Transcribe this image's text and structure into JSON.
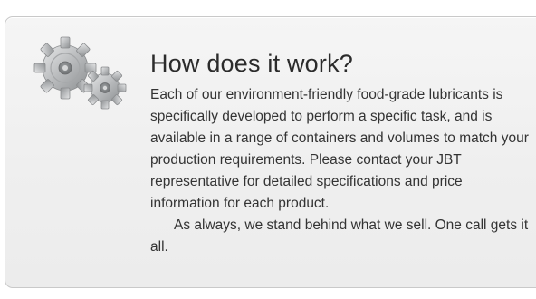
{
  "section": {
    "title": "How does it work?",
    "paragraphs": [
      "Each of our environment-friendly food-grade lubricants is specifically developed to perform a specific task, and is available in a range of containers and volumes to match your production requirements. Please contact your JBT representative for detailed specifications and price information for each product.",
      "As always, we stand behind what we sell. One call gets it all."
    ]
  },
  "icons": {
    "illustration": "gears-icon"
  },
  "colors": {
    "panel_background": "#efefef",
    "panel_border": "#c9c9c9",
    "title_text": "#2b2b2b",
    "body_text": "#333333",
    "gear_metal": "#b8babb"
  }
}
